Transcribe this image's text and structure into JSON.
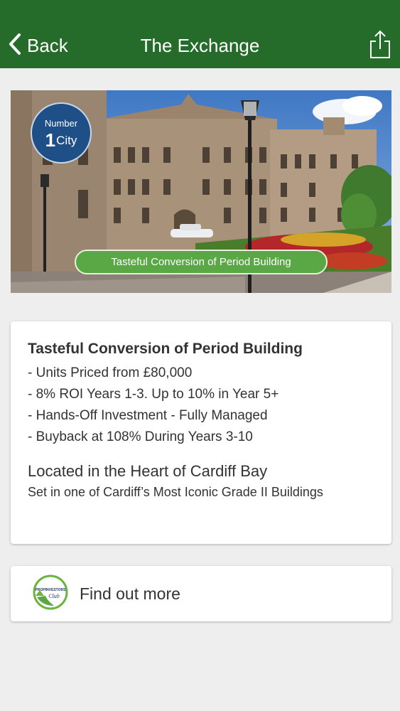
{
  "nav": {
    "back_label": "Back",
    "title": "The Exchange"
  },
  "hero": {
    "badge_top": "Number",
    "badge_number": "1",
    "badge_word": "City",
    "caption": "Tasteful Conversion of Period Building"
  },
  "info": {
    "heading": "Tasteful Conversion of Period Building",
    "bullets": [
      "- Units Priced from £80,000",
      "- 8% ROI Years 1-3. Up to 10% in Year 5+",
      "- Hands-Off Investment - Fully Managed",
      "- Buyback at 108% During Years 3-10"
    ],
    "location_heading": "Located in the Heart of Cardiff Bay",
    "location_text": "Set in one of Cardiff’s Most Iconic Grade II Buildings"
  },
  "cta": {
    "label": "Find out more",
    "logo_text": "PROPINVESTORS Club"
  },
  "colors": {
    "navbar": "#256b2a",
    "pill": "#5aa845",
    "badge": "#1e4f86",
    "background": "#eeeeee"
  },
  "icons": {
    "back": "chevron-left-icon",
    "share": "share-icon",
    "logo": "propinvestors-logo-icon"
  }
}
